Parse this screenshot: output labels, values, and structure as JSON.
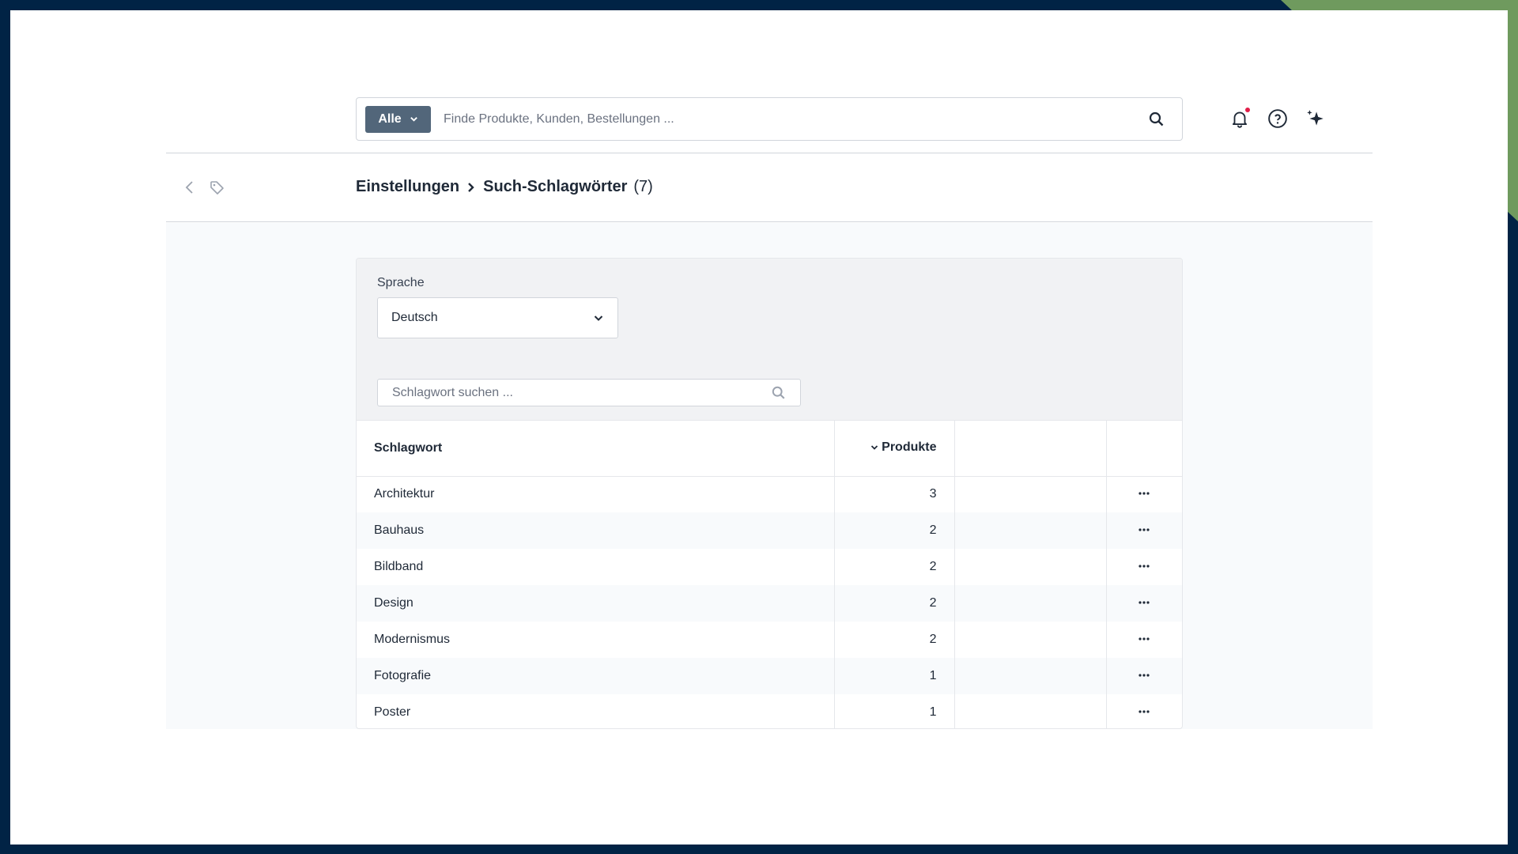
{
  "topbar": {
    "scope_label": "Alle",
    "search_placeholder": "Finde Produkte, Kunden, Bestellungen ..."
  },
  "header": {
    "title_parent": "Einstellungen",
    "title_current": "Such-Schlagwörter",
    "title_count": "(7)"
  },
  "filters": {
    "language_label": "Sprache",
    "language_value": "Deutsch",
    "keyword_placeholder": "Schlagwort suchen ..."
  },
  "table": {
    "columns": [
      "Schlagwort",
      "Produkte",
      "",
      ""
    ],
    "rows": [
      {
        "keyword": "Architektur",
        "products": "3"
      },
      {
        "keyword": "Bauhaus",
        "products": "2"
      },
      {
        "keyword": "Bildband",
        "products": "2"
      },
      {
        "keyword": "Design",
        "products": "2"
      },
      {
        "keyword": "Modernismus",
        "products": "2"
      },
      {
        "keyword": "Fotografie",
        "products": "1"
      },
      {
        "keyword": "Poster",
        "products": "1"
      }
    ]
  },
  "colors": {
    "accent": "#52667a",
    "frame": "#012345",
    "corner": "#6f9a5e",
    "notification": "#e11d48"
  },
  "icons": [
    "search-icon",
    "bell-icon",
    "help-icon",
    "sparkle-icon",
    "back-icon",
    "tag-icon",
    "chevron-down-icon",
    "more-icon"
  ]
}
